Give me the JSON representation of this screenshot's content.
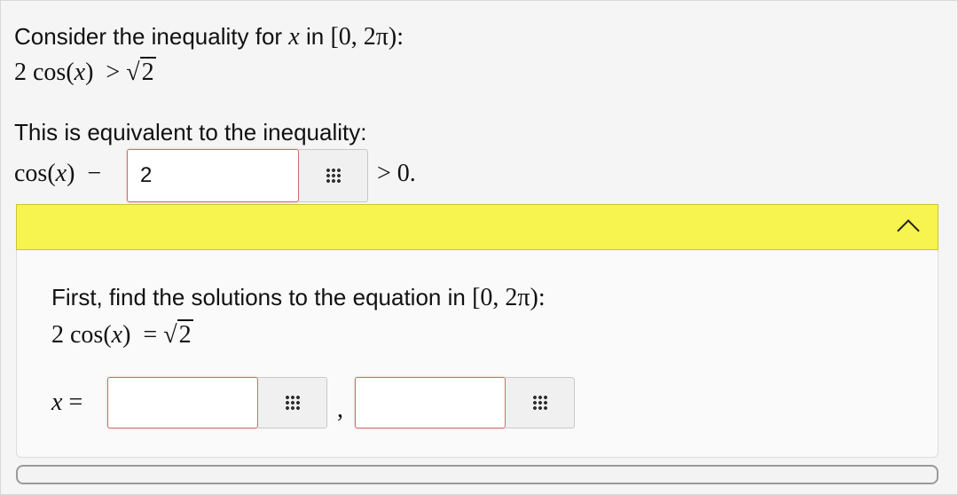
{
  "problem": {
    "intro": "Consider the inequality for",
    "var_x": "x",
    "in_word": "in",
    "interval": "[0, 2π):",
    "ineq_lhs_coef": "2",
    "ineq_cos": "cos",
    "ineq_op": ">",
    "ineq_rhs_radicand": "2",
    "equiv_text": "This is equivalent to the inequality:",
    "equiv_cos": "cos",
    "equiv_minus": "−",
    "equiv_input_value": "2",
    "equiv_rhs": "> 0."
  },
  "hint": {
    "toggle_icon": "chevron-up-icon",
    "bar_color": "#f7f34f",
    "step_text": "First, find the solutions to the equation in",
    "step_interval": "[0, 2π):",
    "eq_coef": "2",
    "eq_cos": "cos",
    "eq_op": "=",
    "eq_radicand": "2",
    "x_label": "x",
    "eq_sign": "=",
    "solution_1_value": "",
    "separator": ",",
    "solution_2_value": ""
  },
  "icons": {
    "keyboard": "grid-keypad-icon"
  },
  "colors": {
    "input_border": "#d46a6a",
    "hint_bar": "#f7f34f"
  }
}
